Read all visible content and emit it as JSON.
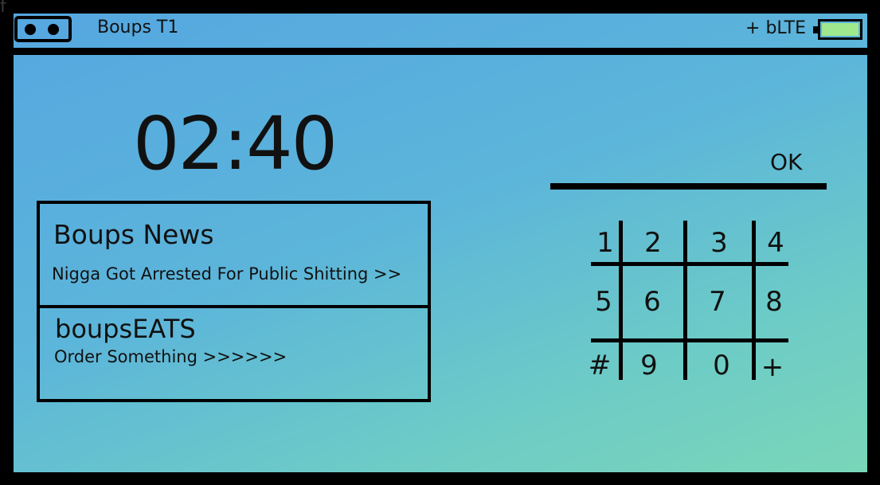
{
  "corner_glyph": "f",
  "statusbar": {
    "device_name": "Boups T1",
    "network": "+ bLTE",
    "colors": {
      "battery_fill": "#9fe88e"
    },
    "icons": {
      "logo": "tape-logo-icon",
      "battery": "battery-icon"
    }
  },
  "clock": {
    "time": "02:40"
  },
  "feed": {
    "news": {
      "title": "Boups News",
      "headline": "Nigga Got Arrested For Public Shitting >>"
    },
    "eats": {
      "title": "boupsEATS",
      "link": "Order Something >>>>>>"
    }
  },
  "dialer": {
    "ok_label": "OK",
    "keys": [
      [
        "1",
        "2",
        "3",
        "4"
      ],
      [
        "5",
        "6",
        "7",
        "8"
      ],
      [
        "#",
        "9",
        "0",
        "+"
      ]
    ]
  }
}
